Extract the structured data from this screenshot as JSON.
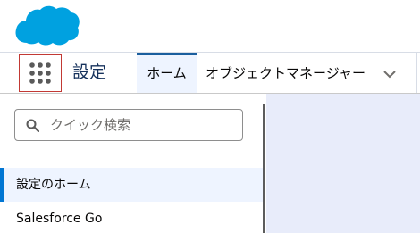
{
  "header": {
    "logo_icon": "salesforce-cloud-logo",
    "brand_color": "#00a1e0"
  },
  "nav": {
    "app_launcher_icon": "app-launcher-grid-icon",
    "app_name": "設定",
    "tabs": [
      {
        "label": "ホーム",
        "active": true
      },
      {
        "label": "オブジェクトマネージャー",
        "active": false
      }
    ],
    "dropdown_icon": "chevron-down-icon"
  },
  "sidebar": {
    "search": {
      "placeholder": "クイック検索",
      "value": ""
    },
    "items": [
      {
        "label": "設定のホーム",
        "selected": true
      },
      {
        "label": "Salesforce Go",
        "selected": false
      }
    ]
  },
  "colors": {
    "accent": "#0176d3",
    "selected_bg": "#eef4ff",
    "main_bg": "#e8ecfa",
    "launcher_border": "#c23934"
  }
}
